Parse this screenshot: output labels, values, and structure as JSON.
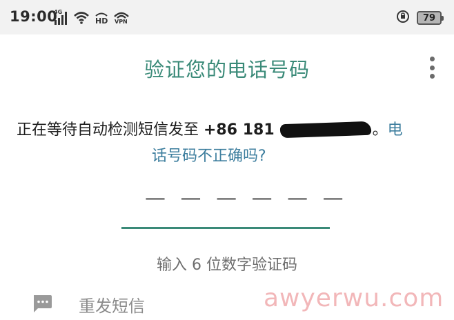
{
  "status_bar": {
    "time": "19:00",
    "network_label": "4G",
    "hd_label": "HD",
    "vpn_label": "VPN",
    "battery_level": "79",
    "icons": [
      "signal-icon",
      "wifi-icon",
      "hd-icon",
      "vpn-icon",
      "alarm-icon",
      "battery-icon"
    ]
  },
  "header": {
    "title": "验证您的电话号码",
    "menu_icon": "more-vert-icon"
  },
  "message": {
    "prefix": "正在等待自动检测短信发至 ",
    "phone_prefix": "+86 181",
    "suffix": "。",
    "link_part1": "电",
    "link_part2": "话号码不正确吗?"
  },
  "code_input": {
    "placeholder": "— — —   — — —",
    "hint": "输入 6 位数字验证码"
  },
  "resend": {
    "label": "重发短信",
    "icon": "sms-icon"
  },
  "watermark": {
    "text": "awyerwu.com"
  },
  "colors": {
    "accent": "#3a8a78",
    "link": "#3d7e9e",
    "status_bar_bg": "#f2f2f2",
    "watermark": "#f2b7b9"
  }
}
